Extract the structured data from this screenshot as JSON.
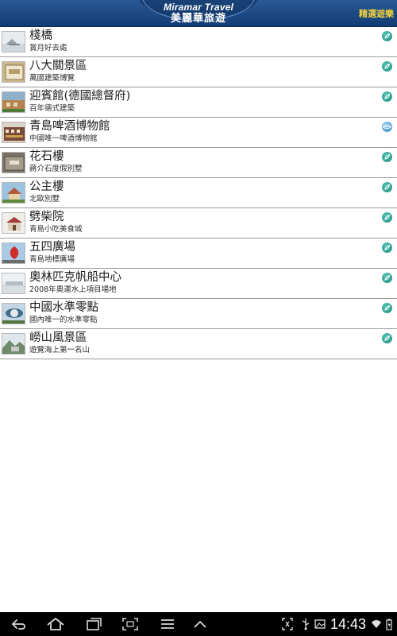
{
  "header": {
    "logo_en": "Miramar Travel",
    "logo_zh": "美麗華旅遊",
    "link_label": "精選遊樂"
  },
  "colors": {
    "header_blue": "#1b4a86",
    "accent_yellow": "#f2d33a",
    "map_icon_teal": "#2a9d8f",
    "globe_icon_blue": "#2d7fc0"
  },
  "attractions": [
    {
      "title": "棧橋",
      "subtitle": "賞月好去處",
      "icon": "map-pin-icon"
    },
    {
      "title": "八大關景區",
      "subtitle": "萬國建築博覽",
      "icon": "map-pin-icon"
    },
    {
      "title": "迎賓館(德國總督府)",
      "subtitle": "百年德式建築",
      "icon": "map-pin-icon"
    },
    {
      "title": "青島啤酒博物館",
      "subtitle": "中國唯一啤酒博物館",
      "icon": "globe-icon"
    },
    {
      "title": "花石樓",
      "subtitle": "蔣介石度假別墅",
      "icon": "map-pin-icon"
    },
    {
      "title": "公主樓",
      "subtitle": "北歐別墅",
      "icon": "map-pin-icon"
    },
    {
      "title": "劈柴院",
      "subtitle": "青島小吃美食城",
      "icon": "map-pin-icon"
    },
    {
      "title": "五四廣場",
      "subtitle": "青島地標廣場",
      "icon": "map-pin-icon"
    },
    {
      "title": "奧林匹克帆船中心",
      "subtitle": "2008年奧運水上項目場地",
      "icon": "map-pin-icon"
    },
    {
      "title": "中國水準零點",
      "subtitle": "國內唯一的水準零點",
      "icon": "map-pin-icon"
    },
    {
      "title": "嶗山風景區",
      "subtitle": "遊覽海上第一名山",
      "icon": "map-pin-icon"
    }
  ],
  "status_bar": {
    "time": "14:43"
  }
}
